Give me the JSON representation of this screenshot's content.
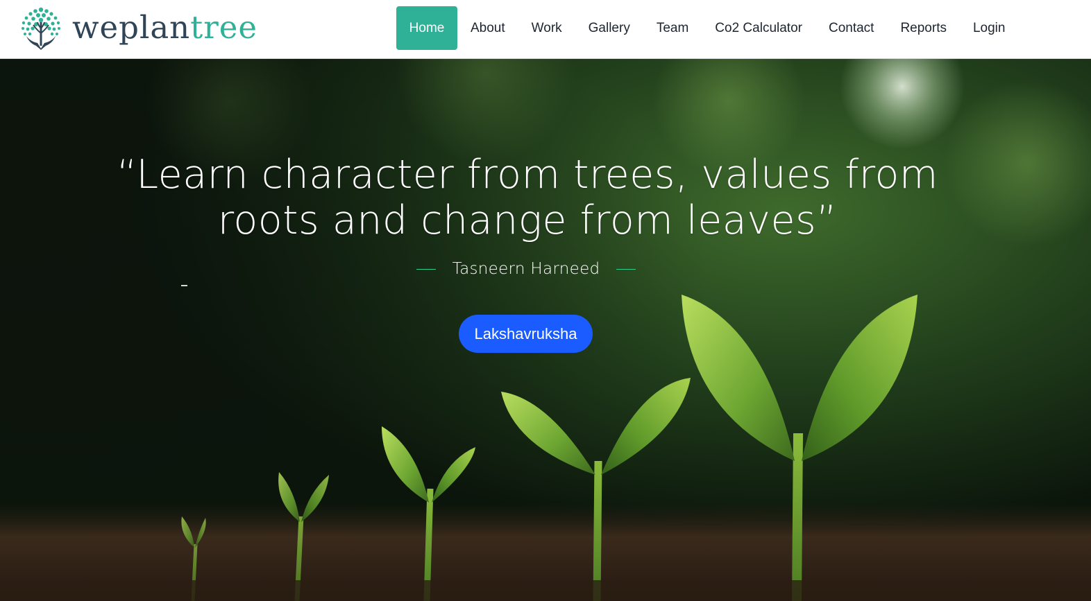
{
  "brand": {
    "name_part1": "weplan",
    "name_part2": "tree",
    "icon": "tree-in-hand-icon",
    "colors": {
      "dark": "#2f4557",
      "accent": "#2fb197"
    }
  },
  "nav": {
    "active_color": "#2fb197",
    "items": [
      {
        "label": "Home",
        "active": true
      },
      {
        "label": "About"
      },
      {
        "label": "Work"
      },
      {
        "label": "Gallery"
      },
      {
        "label": "Team"
      },
      {
        "label": "Co2 Calculator"
      },
      {
        "label": "Contact"
      },
      {
        "label": "Reports"
      },
      {
        "label": "Login"
      }
    ]
  },
  "hero": {
    "quote_line1": "“Learn character from trees, values from",
    "quote_line2": "roots and change from leaves”",
    "author": "Tasneern Harneed",
    "cta_label": "Lakshavruksha",
    "cta_color": "#1a5cff",
    "background": "seedlings-growing-in-soil"
  }
}
